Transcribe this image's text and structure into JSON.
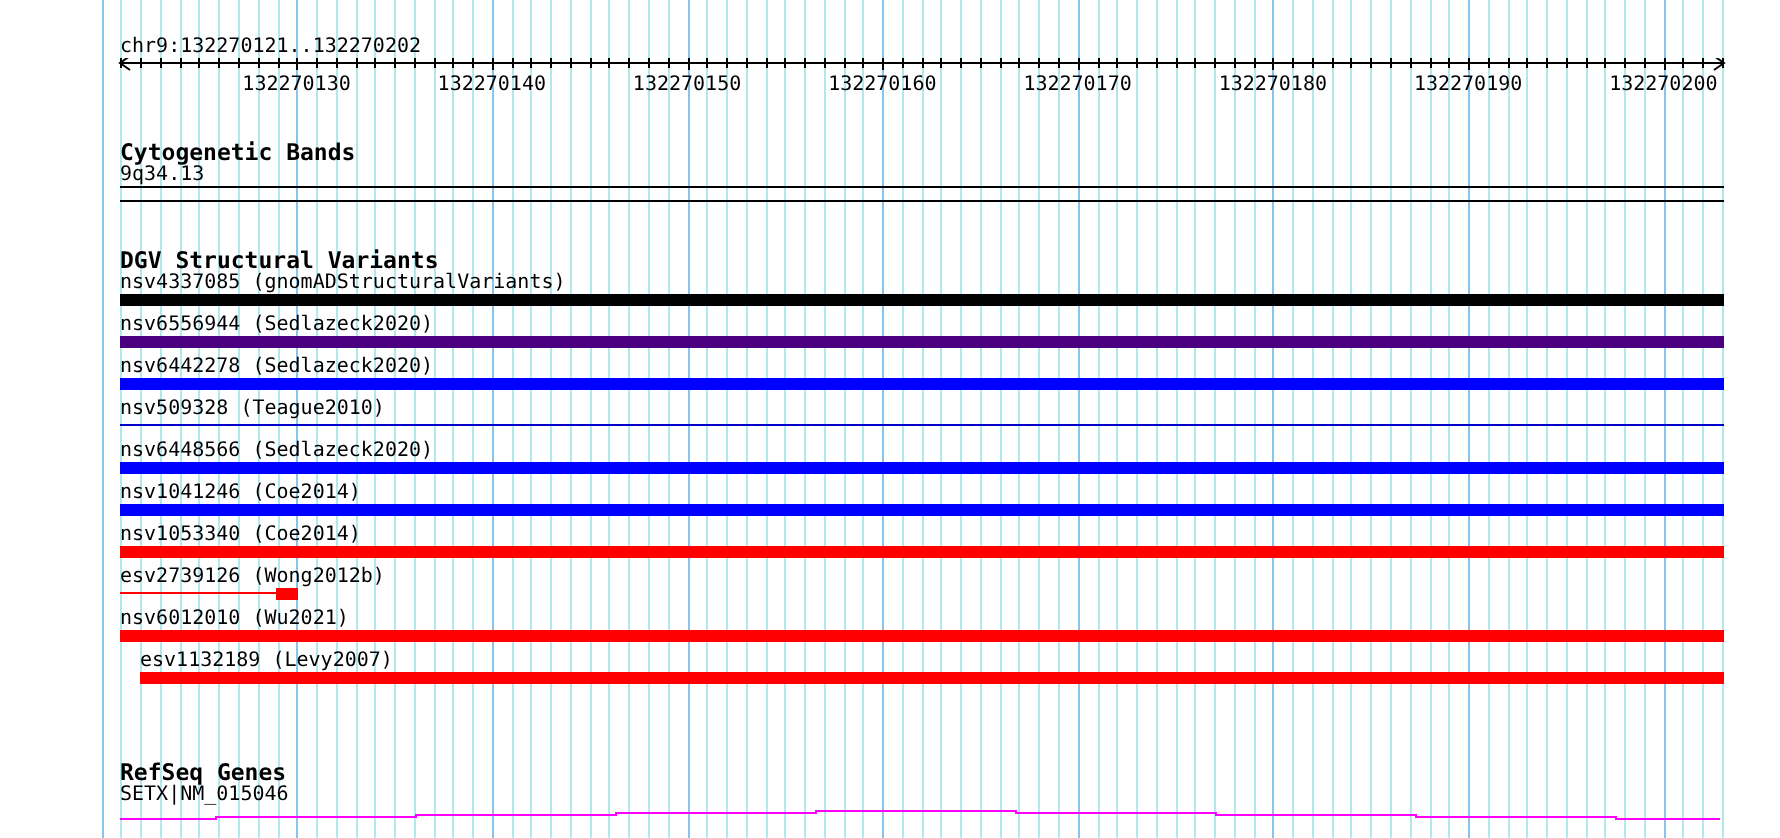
{
  "ruler": {
    "region": "chr9:132270121..132270202",
    "ticks": [
      "132270130",
      "132270140",
      "132270150",
      "132270160",
      "132270170",
      "132270180",
      "132270190",
      "132270200"
    ]
  },
  "cytogenetic_bands": {
    "title": "Cytogenetic Bands",
    "band": "9q34.13"
  },
  "dgv_structural_variants": {
    "title": "DGV Structural Variants",
    "items": [
      {
        "label": "nsv4337085 (gnomADStructuralVariants)",
        "kind": "thick",
        "color": "#000000"
      },
      {
        "label": "nsv6556944 (Sedlazeck2020)",
        "kind": "thick",
        "color": "#4b0082"
      },
      {
        "label": "nsv6442278 (Sedlazeck2020)",
        "kind": "thick",
        "color": "#0000ff"
      },
      {
        "label": "nsv509328 (Teague2010)",
        "kind": "thin",
        "color": "#0000cc"
      },
      {
        "label": "nsv6448566 (Sedlazeck2020)",
        "kind": "thick",
        "color": "#0000ff"
      },
      {
        "label": "nsv1041246 (Coe2014)",
        "kind": "thick",
        "color": "#0000ff"
      },
      {
        "label": "nsv1053340 (Coe2014)",
        "kind": "thick",
        "color": "#ff0000"
      },
      {
        "label": "esv2739126 (Wong2012b)",
        "kind": "partial",
        "color": "#ff0000"
      },
      {
        "label": "nsv6012010 (Wu2021)",
        "kind": "thick",
        "color": "#ff0000"
      },
      {
        "label": "esv1132189 (Levy2007)",
        "kind": "offset",
        "color": "#ff0000"
      }
    ]
  },
  "refseq_genes": {
    "title": "RefSeq Genes",
    "gene": "SETX|NM_015046"
  }
}
